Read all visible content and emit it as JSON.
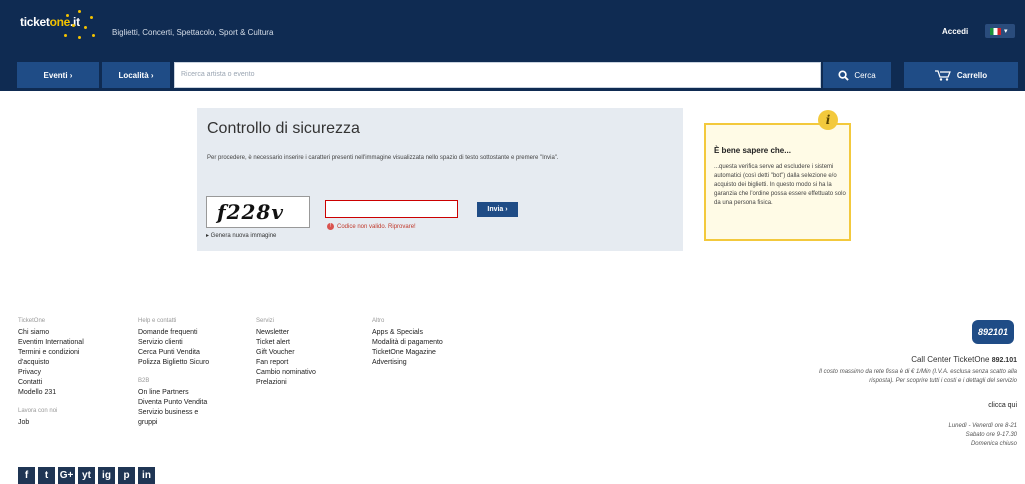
{
  "header": {
    "logo_text_a": "ticket",
    "logo_text_b": "one",
    "logo_text_c": ".it",
    "tagline": "Biglietti, Concerti, Spettacolo, Sport & Cultura",
    "login_label": "Accedi"
  },
  "nav": {
    "events_label": "Eventi ›",
    "location_label": "Località ›",
    "search_placeholder": "Ricerca artista o evento",
    "search_button": "Cerca",
    "cart_button": "Carrello"
  },
  "security": {
    "title": "Controllo di sicurezza",
    "description": "Per procedere, è necessario inserire i caratteri presenti nell'immagine visualizzata nello spazio di testo sottostante e premere \"Invia\".",
    "captcha_text": "f228v",
    "new_image_label": "▸ Genera nuova immagine",
    "input_value": "",
    "error_text": "Codice non valido. Riprovare!",
    "submit_label": "Invia ›"
  },
  "info": {
    "title": "È bene sapere che...",
    "text": "...questa verifica serve ad escludere i sistemi automatici (così detti \"bot\") dalla selezione e/o acquisto dei biglietti. In questo modo si ha la garanzia che l'ordine possa essere effettuato solo da una persona fisica."
  },
  "footer": {
    "col1": {
      "heading": "TicketOne",
      "items": [
        "Chi siamo",
        "Eventim International",
        "Termini e condizioni d'acquisto",
        "Privacy",
        "Contatti",
        "Modello 231"
      ],
      "heading2": "Lavora con noi",
      "items2": [
        "Job"
      ]
    },
    "col2": {
      "heading": "Help e contatti",
      "items": [
        "Domande frequenti",
        "Servizio clienti",
        "Cerca Punti Vendita",
        "Polizza Biglietto Sicuro"
      ],
      "heading2": "B2B",
      "items2": [
        "On line Partners",
        "Diventa Punto Vendita",
        "Servizio business e gruppi"
      ]
    },
    "col3": {
      "heading": "Servizi",
      "items": [
        "Newsletter",
        "Ticket alert",
        "Gift Voucher",
        "Fan report",
        "Cambio nominativo",
        "Prelazioni"
      ]
    },
    "col4": {
      "heading": "Altro",
      "items": [
        "Apps & Specials",
        "Modalità di pagamento",
        "TicketOne Magazine",
        "Advertising"
      ]
    },
    "social": [
      "f",
      "t",
      "G+",
      "yt",
      "ig",
      "p",
      "in"
    ],
    "callcenter": {
      "logo": "892101",
      "title": "Call Center TicketOne",
      "number": "892.101",
      "note": "Il costo massimo da rete fissa è di € 1/Min (I.V.A. esclusa senza scatto alla risposta). Per scoprire tutti i costi e i dettagli del servizio",
      "link": "clicca qui",
      "hours": [
        "Lunedì - Venerdì ore 8-21",
        "Sabato ore 9-17.30",
        "Domenica chiuso"
      ]
    }
  }
}
